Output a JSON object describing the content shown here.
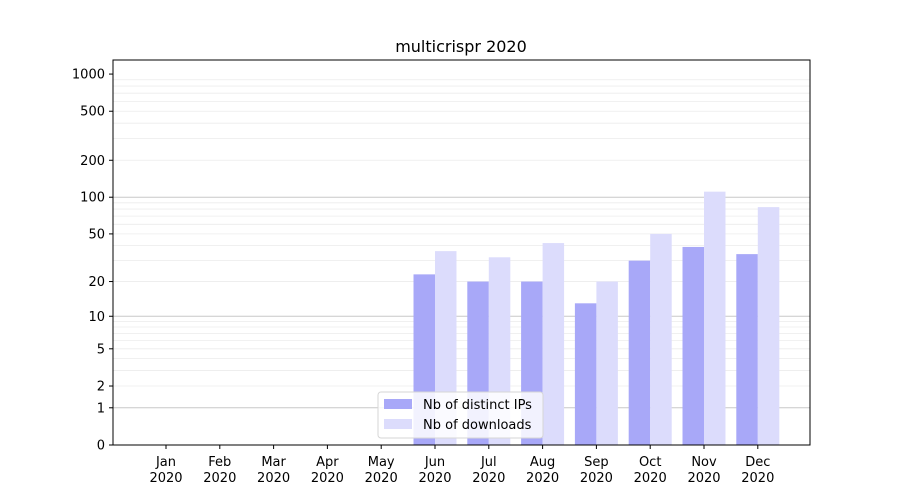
{
  "chart_data": {
    "type": "bar",
    "title": "multicrispr 2020",
    "xlabel": "",
    "ylabel": "",
    "categories": [
      [
        "Jan",
        "2020"
      ],
      [
        "Feb",
        "2020"
      ],
      [
        "Mar",
        "2020"
      ],
      [
        "Apr",
        "2020"
      ],
      [
        "May",
        "2020"
      ],
      [
        "Jun",
        "2020"
      ],
      [
        "Jul",
        "2020"
      ],
      [
        "Aug",
        "2020"
      ],
      [
        "Sep",
        "2020"
      ],
      [
        "Oct",
        "2020"
      ],
      [
        "Nov",
        "2020"
      ],
      [
        "Dec",
        "2020"
      ]
    ],
    "series": [
      {
        "name": "Nb of distinct IPs",
        "color": "#a8a8f8",
        "values": [
          0,
          0,
          0,
          0,
          0,
          23,
          20,
          20,
          13,
          30,
          39,
          34
        ]
      },
      {
        "name": "Nb of downloads",
        "color": "#dcdcfc",
        "values": [
          0,
          0,
          0,
          0,
          0,
          36,
          32,
          42,
          20,
          50,
          111,
          83
        ]
      }
    ],
    "y_scale": "symlog",
    "ylim": [
      0,
      1300
    ],
    "yticks": [
      0,
      1,
      2,
      5,
      10,
      20,
      50,
      100,
      200,
      500,
      1000
    ],
    "ytick_labels": [
      "0",
      "1",
      "2",
      "5",
      "10",
      "20",
      "50",
      "100",
      "200",
      "500",
      "1000"
    ],
    "grid": true,
    "legend_position": "bottom-center"
  }
}
